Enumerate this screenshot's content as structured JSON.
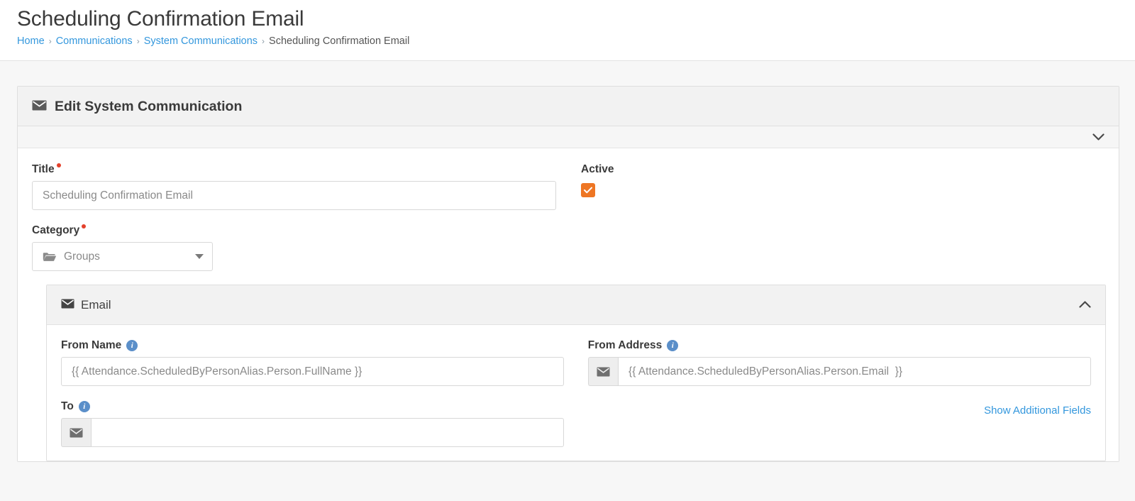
{
  "header": {
    "title": "Scheduling Confirmation Email",
    "breadcrumb": [
      {
        "label": "Home",
        "is_link": true
      },
      {
        "label": "Communications",
        "is_link": true
      },
      {
        "label": "System Communications",
        "is_link": true
      },
      {
        "label": "Scheduling Confirmation Email",
        "is_link": false
      }
    ],
    "separator": "›"
  },
  "panel": {
    "title": "Edit System Communication",
    "icon": "envelope-icon",
    "subbar_toggle_icon": "chevron-down-icon"
  },
  "form": {
    "title_field": {
      "label": "Title",
      "required": true,
      "value": "",
      "placeholder": "Scheduling Confirmation Email"
    },
    "active": {
      "label": "Active",
      "checked": true,
      "color": "#ee7624"
    },
    "category": {
      "label": "Category",
      "required": true,
      "selected": "Groups",
      "icon": "folder-icon",
      "caret_icon": "caret-down-icon"
    }
  },
  "email_panel": {
    "title": "Email",
    "icon": "envelope-icon",
    "toggle_icon": "chevron-up-icon",
    "from_name": {
      "label": "From Name",
      "info_icon": "info-icon",
      "value": "",
      "placeholder": "{{ Attendance.ScheduledByPersonAlias.Person.FullName }}"
    },
    "from_address": {
      "label": "From Address",
      "info_icon": "info-icon",
      "addon_icon": "envelope-icon",
      "value": "",
      "placeholder": "{{ Attendance.ScheduledByPersonAlias.Person.Email  }}"
    },
    "to": {
      "label": "To",
      "info_icon": "info-icon",
      "addon_icon": "envelope-icon",
      "value": "",
      "placeholder": ""
    },
    "show_additional_fields_link": "Show Additional Fields"
  },
  "colors": {
    "link": "#3397dd",
    "accent_orange": "#ee7624",
    "required_red": "#e4412c",
    "info_blue": "#5b8fc9"
  }
}
